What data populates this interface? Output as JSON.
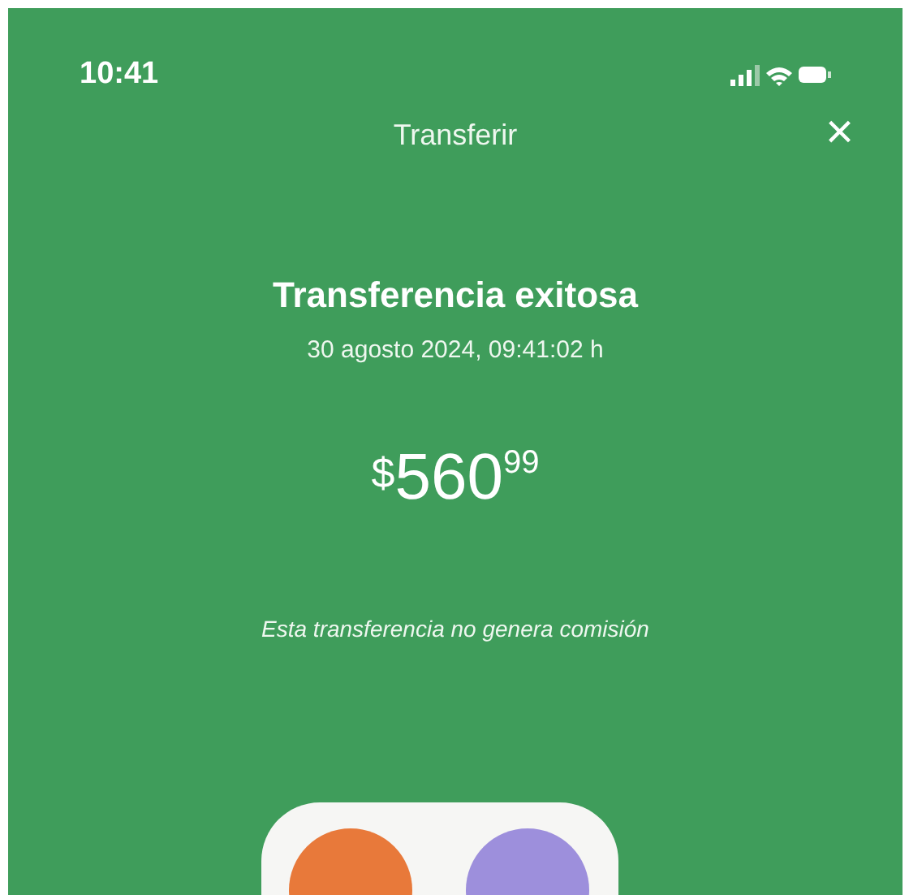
{
  "status_bar": {
    "time": "10:41"
  },
  "header": {
    "title": "Transferir",
    "close": "×"
  },
  "result": {
    "title": "Transferencia exitosa",
    "date": "30 agosto 2024, 09:41:02 h",
    "currency": "$",
    "amount": "560",
    "cents": "99",
    "note": "Esta transferencia no genera comisión"
  },
  "avatars": [
    {
      "color": "#e8793a"
    },
    {
      "color": "#9d8fdc"
    }
  ]
}
